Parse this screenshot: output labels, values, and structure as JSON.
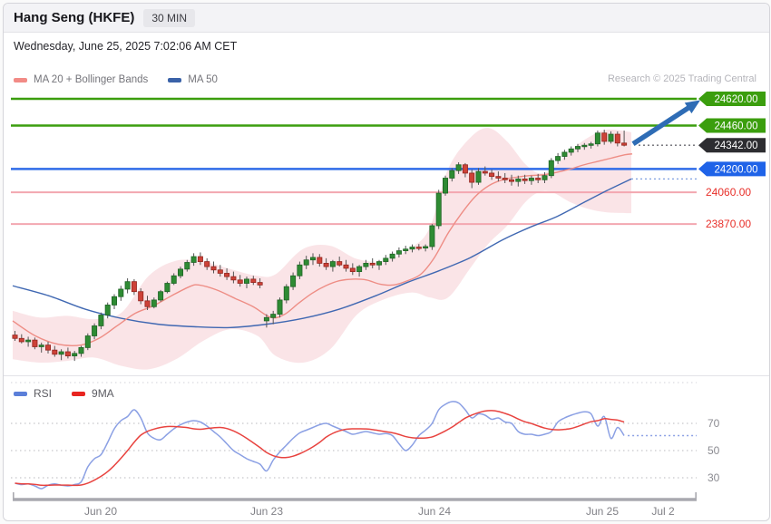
{
  "header": {
    "title": "Hang Seng (HKFE)",
    "timeframe_badge": "30 MIN"
  },
  "datetime_line": "Wednesday, June 25, 2025 7:02:06 AM CET",
  "watermark": "Research © 2025 Trading Central",
  "main_legend": [
    {
      "label": "MA 20 + Bollinger Bands",
      "color": "#f28b86"
    },
    {
      "label": "MA 50",
      "color": "#3a62a8"
    }
  ],
  "rsi_legend": [
    {
      "label": "RSI",
      "color": "#5b7fd9"
    },
    {
      "label": "9MA",
      "color": "#e82520"
    }
  ],
  "colors": {
    "resistance_line": "#3b9e0e",
    "pivot_line": "#2f6be8",
    "support_line": "#f3a7b0",
    "support_text": "#e8302a",
    "last_tag": "#2d2d31",
    "pivot_tag": "#1f63e8",
    "candle_up": "#2e8b33",
    "candle_down": "#cd4238",
    "band_fill": "#f5c9d0",
    "ma20": "#ee8d85",
    "ma50": "#4068b2",
    "arrow": "#2e6cb5",
    "rsi_line": "#8ba0e4",
    "rsi_ma_line": "#e8433f"
  },
  "chart_data": [
    {
      "type": "candlestick",
      "title": "Hang Seng (HKFE) 30 MIN",
      "x_axis_labels": [
        "Jun 20",
        "Jun 23",
        "Jun 24",
        "Jun 25",
        "Jul 2"
      ],
      "last_price": 24342.0,
      "price_levels": [
        {
          "value": 24620.0,
          "kind": "resistance",
          "style": "tag",
          "tag_color": "#3b9e0e",
          "line_color": "#3b9e0e"
        },
        {
          "value": 24460.0,
          "kind": "resistance",
          "style": "tag",
          "tag_color": "#3b9e0e",
          "line_color": "#3b9e0e"
        },
        {
          "value": 24342.0,
          "kind": "last",
          "style": "tag-dotted",
          "tag_color": "#2d2d31",
          "line_color": "#6a6a70"
        },
        {
          "value": 24200.0,
          "kind": "pivot",
          "style": "tag",
          "tag_color": "#1f63e8",
          "line_color": "#2f6be8"
        },
        {
          "value": 24060.0,
          "kind": "support",
          "style": "text",
          "tag_color": "#e8302a",
          "line_color": "#f3a7b0"
        },
        {
          "value": 23870.0,
          "kind": "support",
          "style": "text",
          "tag_color": "#e8302a",
          "line_color": "#f3a7b0"
        }
      ],
      "forecast_arrow": {
        "from": 24342,
        "to": 24620,
        "direction": "up"
      },
      "ma50_projection": {
        "value": 24140,
        "style": "dotted-blue"
      },
      "candles_ohlc": [
        [
          23205,
          23230,
          23170,
          23185
        ],
        [
          23185,
          23210,
          23155,
          23165
        ],
        [
          23165,
          23195,
          23135,
          23175
        ],
        [
          23175,
          23190,
          23120,
          23135
        ],
        [
          23135,
          23160,
          23100,
          23145
        ],
        [
          23145,
          23165,
          23095,
          23115
        ],
        [
          23115,
          23140,
          23075,
          23090
        ],
        [
          23090,
          23120,
          23055,
          23105
        ],
        [
          23105,
          23130,
          23065,
          23080
        ],
        [
          23080,
          23110,
          23050,
          23095
        ],
        [
          23095,
          23140,
          23075,
          23130
        ],
        [
          23130,
          23215,
          23115,
          23200
        ],
        [
          23200,
          23275,
          23180,
          23260
        ],
        [
          23260,
          23340,
          23240,
          23325
        ],
        [
          23325,
          23400,
          23305,
          23385
        ],
        [
          23385,
          23450,
          23360,
          23435
        ],
        [
          23435,
          23500,
          23410,
          23480
        ],
        [
          23480,
          23545,
          23455,
          23525
        ],
        [
          23525,
          23540,
          23445,
          23465
        ],
        [
          23465,
          23485,
          23390,
          23410
        ],
        [
          23410,
          23440,
          23355,
          23375
        ],
        [
          23375,
          23430,
          23365,
          23415
        ],
        [
          23415,
          23475,
          23405,
          23465
        ],
        [
          23465,
          23525,
          23455,
          23515
        ],
        [
          23515,
          23575,
          23505,
          23560
        ],
        [
          23560,
          23615,
          23545,
          23600
        ],
        [
          23600,
          23655,
          23585,
          23640
        ],
        [
          23640,
          23695,
          23620,
          23675
        ],
        [
          23675,
          23700,
          23625,
          23645
        ],
        [
          23645,
          23665,
          23595,
          23615
        ],
        [
          23615,
          23645,
          23575,
          23595
        ],
        [
          23595,
          23625,
          23555,
          23575
        ],
        [
          23575,
          23605,
          23535,
          23555
        ],
        [
          23555,
          23585,
          23515,
          23535
        ],
        [
          23535,
          23565,
          23495,
          23515
        ],
        [
          23515,
          23555,
          23485,
          23540
        ],
        [
          23540,
          23560,
          23505,
          23520
        ],
        [
          23520,
          23545,
          23485,
          23505
        ],
        [
          23290,
          23330,
          23250,
          23310
        ],
        [
          23310,
          23350,
          23270,
          23330
        ],
        [
          23330,
          23430,
          23310,
          23415
        ],
        [
          23415,
          23510,
          23395,
          23495
        ],
        [
          23495,
          23580,
          23475,
          23560
        ],
        [
          23560,
          23645,
          23540,
          23625
        ],
        [
          23625,
          23680,
          23600,
          23655
        ],
        [
          23655,
          23695,
          23625,
          23670
        ],
        [
          23670,
          23690,
          23615,
          23635
        ],
        [
          23635,
          23665,
          23595,
          23615
        ],
        [
          23615,
          23655,
          23585,
          23645
        ],
        [
          23645,
          23675,
          23615,
          23625
        ],
        [
          23625,
          23655,
          23585,
          23605
        ],
        [
          23605,
          23635,
          23565,
          23585
        ],
        [
          23585,
          23625,
          23555,
          23615
        ],
        [
          23615,
          23655,
          23595,
          23635
        ],
        [
          23635,
          23665,
          23605,
          23625
        ],
        [
          23625,
          23655,
          23595,
          23645
        ],
        [
          23645,
          23685,
          23625,
          23665
        ],
        [
          23665,
          23705,
          23645,
          23690
        ],
        [
          23690,
          23730,
          23670,
          23710
        ],
        [
          23710,
          23740,
          23690,
          23720
        ],
        [
          23720,
          23748,
          23700,
          23732
        ],
        [
          23732,
          23750,
          23712,
          23726
        ],
        [
          23726,
          23748,
          23706,
          23735
        ],
        [
          23735,
          23870,
          23715,
          23860
        ],
        [
          23860,
          24075,
          23840,
          24055
        ],
        [
          24055,
          24160,
          24040,
          24145
        ],
        [
          24145,
          24205,
          24125,
          24190
        ],
        [
          24190,
          24240,
          24170,
          24225
        ],
        [
          24225,
          24235,
          24150,
          24175
        ],
        [
          24175,
          24195,
          24085,
          24120
        ],
        [
          24120,
          24205,
          24105,
          24185
        ],
        [
          24185,
          24215,
          24160,
          24175
        ],
        [
          24175,
          24195,
          24135,
          24155
        ],
        [
          24155,
          24185,
          24125,
          24145
        ],
        [
          24145,
          24175,
          24115,
          24135
        ],
        [
          24135,
          24165,
          24100,
          24125
        ],
        [
          24125,
          24160,
          24095,
          24140
        ],
        [
          24140,
          24165,
          24110,
          24130
        ],
        [
          24130,
          24160,
          24105,
          24145
        ],
        [
          24145,
          24170,
          24115,
          24135
        ],
        [
          24135,
          24180,
          24115,
          24160
        ],
        [
          24160,
          24265,
          24145,
          24250
        ],
        [
          24250,
          24295,
          24230,
          24275
        ],
        [
          24275,
          24315,
          24255,
          24300
        ],
        [
          24300,
          24335,
          24280,
          24320
        ],
        [
          24320,
          24350,
          24300,
          24335
        ],
        [
          24335,
          24355,
          24315,
          24342
        ],
        [
          24342,
          24362,
          24322,
          24350
        ],
        [
          24350,
          24430,
          24335,
          24415
        ],
        [
          24415,
          24435,
          24345,
          24365
        ],
        [
          24365,
          24425,
          24352,
          24408
        ],
        [
          24408,
          24425,
          24335,
          24355
        ],
        [
          24355,
          24430,
          24335,
          24342
        ]
      ],
      "ma50_points": [
        [
          10,
          23500
        ],
        [
          50,
          23440
        ],
        [
          90,
          23360
        ],
        [
          130,
          23305
        ],
        [
          170,
          23270
        ],
        [
          210,
          23255
        ],
        [
          250,
          23250
        ],
        [
          290,
          23270
        ],
        [
          330,
          23305
        ],
        [
          370,
          23360
        ],
        [
          410,
          23440
        ],
        [
          445,
          23520
        ],
        [
          480,
          23590
        ],
        [
          515,
          23670
        ],
        [
          550,
          23775
        ],
        [
          580,
          23850
        ],
        [
          610,
          23915
        ],
        [
          640,
          24000
        ],
        [
          665,
          24070
        ],
        [
          692,
          24140
        ]
      ],
      "ma20_points": [
        [
          10,
          23290
        ],
        [
          35,
          23200
        ],
        [
          60,
          23150
        ],
        [
          85,
          23145
        ],
        [
          105,
          23185
        ],
        [
          125,
          23260
        ],
        [
          145,
          23335
        ],
        [
          165,
          23380
        ],
        [
          185,
          23440
        ],
        [
          205,
          23495
        ],
        [
          215,
          23505
        ],
        [
          235,
          23475
        ],
        [
          255,
          23425
        ],
        [
          275,
          23375
        ],
        [
          295,
          23310
        ],
        [
          310,
          23330
        ],
        [
          325,
          23395
        ],
        [
          340,
          23455
        ],
        [
          355,
          23500
        ],
        [
          370,
          23530
        ],
        [
          385,
          23540
        ],
        [
          400,
          23535
        ],
        [
          415,
          23510
        ],
        [
          430,
          23505
        ],
        [
          445,
          23530
        ],
        [
          460,
          23570
        ],
        [
          475,
          23670
        ],
        [
          490,
          23815
        ],
        [
          505,
          23935
        ],
        [
          520,
          24035
        ],
        [
          535,
          24100
        ],
        [
          550,
          24135
        ],
        [
          565,
          24150
        ],
        [
          580,
          24160
        ],
        [
          595,
          24165
        ],
        [
          610,
          24180
        ],
        [
          625,
          24200
        ],
        [
          640,
          24225
        ],
        [
          655,
          24245
        ],
        [
          670,
          24265
        ],
        [
          685,
          24285
        ],
        [
          693,
          24290
        ]
      ],
      "bollinger_upper": [
        [
          10,
          23350
        ],
        [
          40,
          23310
        ],
        [
          70,
          23320
        ],
        [
          100,
          23300
        ],
        [
          130,
          23340
        ],
        [
          160,
          23560
        ],
        [
          190,
          23650
        ],
        [
          220,
          23645
        ],
        [
          250,
          23600
        ],
        [
          280,
          23560
        ],
        [
          300,
          23570
        ],
        [
          330,
          23720
        ],
        [
          360,
          23740
        ],
        [
          390,
          23660
        ],
        [
          420,
          23650
        ],
        [
          450,
          23730
        ],
        [
          470,
          23850
        ],
        [
          490,
          24200
        ],
        [
          515,
          24390
        ],
        [
          535,
          24445
        ],
        [
          555,
          24365
        ],
        [
          575,
          24230
        ],
        [
          590,
          24175
        ],
        [
          605,
          24200
        ],
        [
          625,
          24310
        ],
        [
          645,
          24390
        ],
        [
          665,
          24435
        ],
        [
          692,
          24420
        ]
      ],
      "bollinger_lower": [
        [
          10,
          23060
        ],
        [
          40,
          23040
        ],
        [
          70,
          23050
        ],
        [
          100,
          23070
        ],
        [
          130,
          23020
        ],
        [
          160,
          23000
        ],
        [
          190,
          23060
        ],
        [
          220,
          23170
        ],
        [
          250,
          23240
        ],
        [
          280,
          23200
        ],
        [
          300,
          23080
        ],
        [
          330,
          23040
        ],
        [
          360,
          23120
        ],
        [
          390,
          23330
        ],
        [
          420,
          23420
        ],
        [
          450,
          23460
        ],
        [
          470,
          23430
        ],
        [
          490,
          23430
        ],
        [
          515,
          23610
        ],
        [
          535,
          23755
        ],
        [
          555,
          23860
        ],
        [
          575,
          24000
        ],
        [
          590,
          24060
        ],
        [
          605,
          24060
        ],
        [
          625,
          24000
        ],
        [
          645,
          23960
        ],
        [
          665,
          23940
        ],
        [
          692,
          23935
        ]
      ]
    },
    {
      "type": "line",
      "title": "RSI",
      "ylim": [
        0,
        100
      ],
      "gridlines": [
        100,
        70,
        50,
        30
      ],
      "gridline_labels": [
        "70",
        "50",
        "30"
      ],
      "series": [
        {
          "name": "RSI",
          "values": [
            26,
            25,
            25.5,
            24,
            22,
            24.5,
            25.5,
            24.5,
            24,
            25,
            27,
            38,
            44,
            47,
            56,
            66,
            72,
            75,
            80,
            74,
            63,
            59,
            58,
            62,
            66,
            69,
            71,
            72,
            71,
            68,
            64,
            60,
            55,
            50,
            47,
            44,
            42,
            40,
            35,
            43,
            49,
            54,
            59,
            63,
            65,
            67,
            69,
            70,
            68,
            66,
            64,
            62,
            63,
            64,
            63,
            62,
            62.5,
            61,
            55,
            50,
            54,
            61,
            65,
            70,
            80,
            84,
            86,
            85,
            80,
            74,
            77,
            76,
            73,
            74,
            71,
            70,
            64,
            62,
            62,
            61,
            62,
            64,
            71,
            74,
            76,
            77.5,
            78.5,
            77,
            68,
            75,
            59,
            67,
            61
          ]
        },
        {
          "name": "9MA",
          "derived_from": "RSI",
          "method": "9-period moving average"
        }
      ],
      "projection": {
        "value": 61,
        "style": "dotted"
      }
    }
  ],
  "x_axis": {
    "labels": [
      "Jun 20",
      "Jun 23",
      "Jun 24",
      "Jun 25",
      "Jul 2"
    ]
  }
}
